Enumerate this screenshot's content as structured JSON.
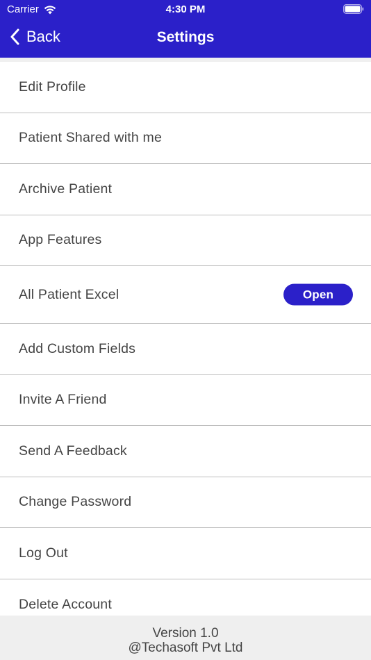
{
  "status_bar": {
    "carrier": "Carrier",
    "time": "4:30 PM"
  },
  "nav": {
    "back_label": "Back",
    "title": "Settings"
  },
  "colors": {
    "brand": "#2b20c9",
    "text": "#444444",
    "divider": "#bdbdbd",
    "footer_bg": "#efefef"
  },
  "settings": {
    "items": [
      {
        "label": "Edit Profile"
      },
      {
        "label": "Patient Shared with me"
      },
      {
        "label": "Archive Patient"
      },
      {
        "label": "App Features"
      },
      {
        "label": "All Patient Excel",
        "action_label": "Open"
      },
      {
        "label": "Add Custom Fields"
      },
      {
        "label": "Invite A Friend"
      },
      {
        "label": "Send A Feedback"
      },
      {
        "label": "Change Password"
      },
      {
        "label": "Log Out"
      },
      {
        "label": "Delete Account"
      }
    ]
  },
  "footer": {
    "version": "Version 1.0",
    "copyright": "@Techasoft Pvt Ltd"
  },
  "icons": {
    "wifi": "wifi-icon",
    "battery": "battery-icon",
    "back": "chevron-left-icon"
  }
}
